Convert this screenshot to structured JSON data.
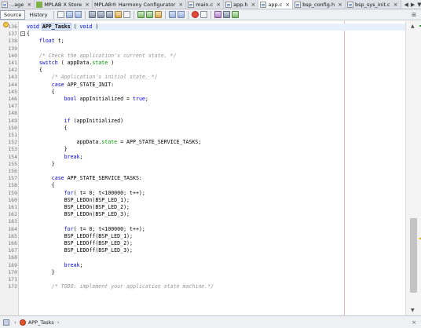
{
  "tabs": [
    {
      "label": "...age",
      "icon": "file-icon",
      "active": false
    },
    {
      "label": "MPLAB X Store",
      "icon": "store-icon",
      "active": false
    },
    {
      "label": "MPLAB® Harmony Configurator",
      "icon": "",
      "active": false
    },
    {
      "label": "main.c",
      "icon": "file-icon",
      "active": false
    },
    {
      "label": "app.h",
      "icon": "file-icon",
      "active": false
    },
    {
      "label": "app.c",
      "icon": "file-icon",
      "active": true
    },
    {
      "label": "bsp_config.h",
      "icon": "file-icon",
      "active": false
    },
    {
      "label": "bsp_sys_init.c",
      "icon": "file-icon",
      "active": false
    }
  ],
  "toolbar": {
    "source_label": "Source",
    "history_label": "History"
  },
  "code": {
    "first_line": 136,
    "current_line": 136,
    "lines": [
      [
        {
          "t": "void ",
          "c": "kw"
        },
        {
          "t": "APP_Tasks",
          "c": "hl"
        },
        {
          "t": " ( ",
          "c": ""
        },
        {
          "t": "void",
          "c": "kw"
        },
        {
          "t": " )",
          "c": ""
        }
      ],
      [
        {
          "t": "{",
          "c": ""
        }
      ],
      [
        {
          "t": "    ",
          "c": ""
        },
        {
          "t": "float",
          "c": "kw"
        },
        {
          "t": " t;",
          "c": ""
        }
      ],
      [],
      [
        {
          "t": "    /* Check the application's current state. */",
          "c": "cm"
        }
      ],
      [
        {
          "t": "    ",
          "c": ""
        },
        {
          "t": "switch",
          "c": "kw"
        },
        {
          "t": " ( appData.",
          "c": ""
        },
        {
          "t": "state",
          "c": "mem"
        },
        {
          "t": " )",
          "c": ""
        }
      ],
      [
        {
          "t": "    {",
          "c": ""
        }
      ],
      [
        {
          "t": "        /* Application's initial state. */",
          "c": "cm"
        }
      ],
      [
        {
          "t": "        ",
          "c": ""
        },
        {
          "t": "case",
          "c": "kw"
        },
        {
          "t": " APP_STATE_INIT:",
          "c": ""
        }
      ],
      [
        {
          "t": "        {",
          "c": ""
        }
      ],
      [
        {
          "t": "            ",
          "c": ""
        },
        {
          "t": "bool",
          "c": "kw"
        },
        {
          "t": " appInitialized = ",
          "c": ""
        },
        {
          "t": "true",
          "c": "kw"
        },
        {
          "t": ";",
          "c": ""
        }
      ],
      [],
      [],
      [
        {
          "t": "            ",
          "c": ""
        },
        {
          "t": "if",
          "c": "kw"
        },
        {
          "t": " (appInitialized)",
          "c": ""
        }
      ],
      [
        {
          "t": "            {",
          "c": ""
        }
      ],
      [],
      [
        {
          "t": "                appData.",
          "c": ""
        },
        {
          "t": "state",
          "c": "mem"
        },
        {
          "t": " = APP_STATE_SERVICE_TASKS;",
          "c": ""
        }
      ],
      [
        {
          "t": "            }",
          "c": ""
        }
      ],
      [
        {
          "t": "            ",
          "c": ""
        },
        {
          "t": "break",
          "c": "kw"
        },
        {
          "t": ";",
          "c": ""
        }
      ],
      [
        {
          "t": "        }",
          "c": ""
        }
      ],
      [],
      [
        {
          "t": "        ",
          "c": ""
        },
        {
          "t": "case",
          "c": "kw"
        },
        {
          "t": " APP_STATE_SERVICE_TASKS:",
          "c": ""
        }
      ],
      [
        {
          "t": "        {",
          "c": ""
        }
      ],
      [
        {
          "t": "            ",
          "c": ""
        },
        {
          "t": "for",
          "c": "kw"
        },
        {
          "t": "( t= 0; t<100000; t++);",
          "c": ""
        }
      ],
      [
        {
          "t": "            BSP_LEDOn(BSP_LED_1);",
          "c": ""
        }
      ],
      [
        {
          "t": "            BSP_LEDOn(BSP_LED_2);",
          "c": ""
        }
      ],
      [
        {
          "t": "            BSP_LEDOn(BSP_LED_3);",
          "c": ""
        }
      ],
      [],
      [
        {
          "t": "            ",
          "c": ""
        },
        {
          "t": "for",
          "c": "kw"
        },
        {
          "t": "( t= 0; t<100000; t++);",
          "c": ""
        }
      ],
      [
        {
          "t": "            BSP_LEDOff(BSP_LED_1);",
          "c": ""
        }
      ],
      [
        {
          "t": "            BSP_LEDOff(BSP_LED_2);",
          "c": ""
        }
      ],
      [
        {
          "t": "            BSP_LEDOff(BSP_LED_3);",
          "c": ""
        }
      ],
      [],
      [
        {
          "t": "            ",
          "c": ""
        },
        {
          "t": "break",
          "c": "kw"
        },
        {
          "t": ";",
          "c": ""
        }
      ],
      [
        {
          "t": "        }",
          "c": ""
        }
      ],
      [],
      [
        {
          "t": "        /* TODO: implement your application state machine.*/",
          "c": "cm"
        }
      ]
    ]
  },
  "breadcrumb": {
    "function_label": "APP_Tasks"
  }
}
